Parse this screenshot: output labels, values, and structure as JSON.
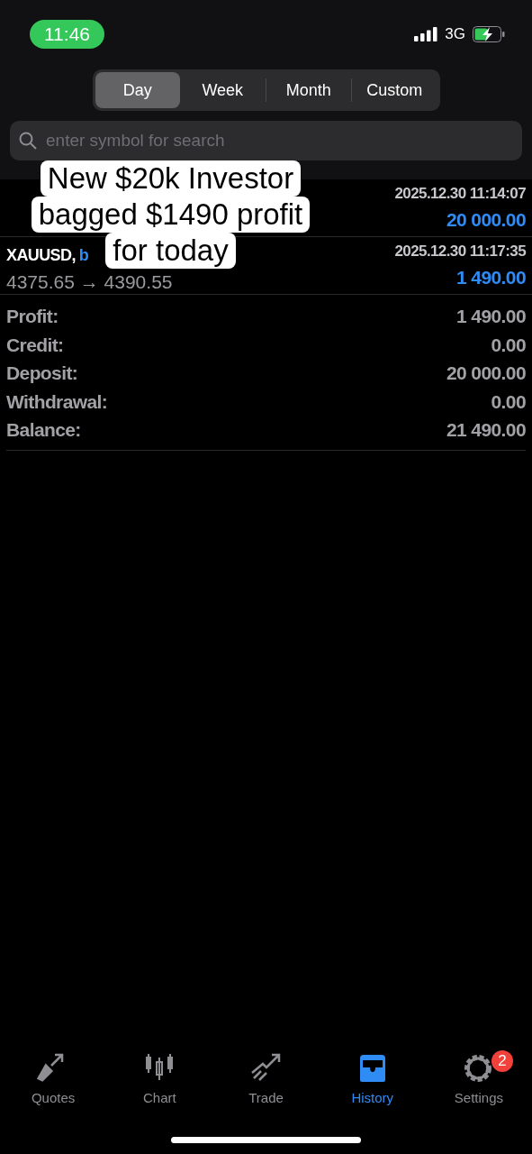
{
  "status_bar": {
    "time": "11:46",
    "network": "3G"
  },
  "periods": [
    {
      "label": "Day",
      "selected": true
    },
    {
      "label": "Week",
      "selected": false
    },
    {
      "label": "Month",
      "selected": false
    },
    {
      "label": "Custom",
      "selected": false
    }
  ],
  "search": {
    "placeholder": "enter symbol for search"
  },
  "deals": [
    {
      "time": "2025.12.30 11:14:07",
      "amount": "20 000.00"
    },
    {
      "symbol": "XAUUSD,",
      "type": "b",
      "prices": "4375.65 → 4390.55",
      "time": "2025.12.30 11:17:35",
      "amount": "1 490.00"
    }
  ],
  "summary": [
    {
      "label": "Profit:",
      "value": "1 490.00"
    },
    {
      "label": "Credit:",
      "value": "0.00"
    },
    {
      "label": "Deposit:",
      "value": "20 000.00"
    },
    {
      "label": "Withdrawal:",
      "value": "0.00"
    },
    {
      "label": "Balance:",
      "value": "21 490.00"
    }
  ],
  "caption": [
    "New $20k Investor",
    "bagged $1490 profit",
    "for today"
  ],
  "tabs": [
    {
      "label": "Quotes",
      "kind": "quotes",
      "selected": false
    },
    {
      "label": "Chart",
      "kind": "chart",
      "selected": false
    },
    {
      "label": "Trade",
      "kind": "trade",
      "selected": false
    },
    {
      "label": "History",
      "kind": "history",
      "selected": true
    },
    {
      "label": "Settings",
      "kind": "settings",
      "selected": false,
      "badge": "2"
    }
  ]
}
